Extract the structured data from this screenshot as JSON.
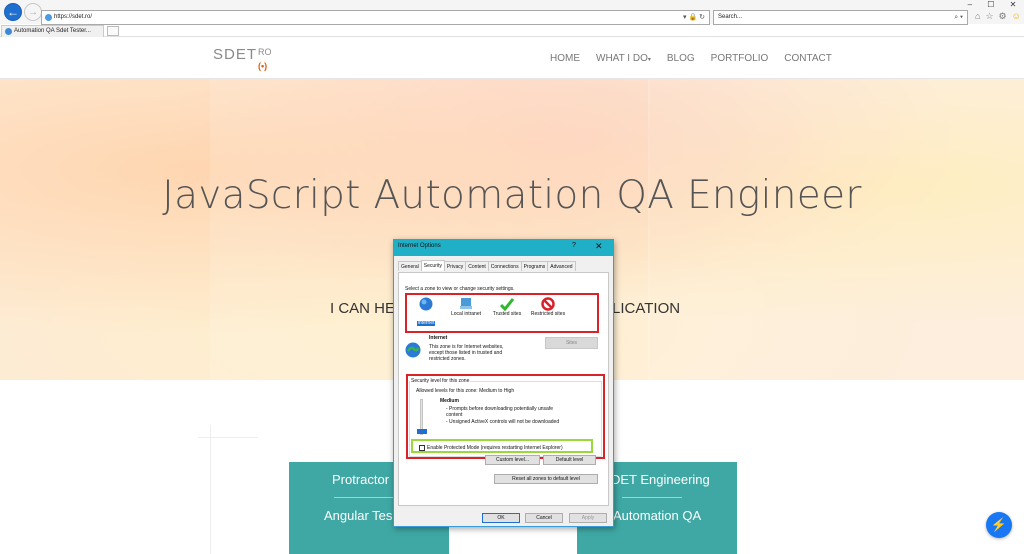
{
  "browser": {
    "url": "https://sdet.ro/",
    "address_icons": "▾ 🔒 ↻",
    "search_placeholder": "Search...",
    "search_icons": "⌕ ▾",
    "tab_title": "Automation QA Sdet Tester...",
    "window_controls": {
      "minimize": "–",
      "maximize": "☐",
      "close": "✕"
    },
    "toolbar_icons": [
      "home-icon",
      "star-icon",
      "gear-icon",
      "smiley-icon"
    ]
  },
  "site": {
    "logo_main": "SDET",
    "logo_signal": "(•)",
    "logo_suffix": "RO",
    "nav": [
      {
        "label": "HOME"
      },
      {
        "label": "WHAT I DO",
        "has_dropdown": true
      },
      {
        "label": "BLOG"
      },
      {
        "label": "PORTFOLIO"
      },
      {
        "label": "CONTACT"
      }
    ],
    "hero_title": "JavaScript Automation QA Engineer",
    "hero_subtitle_left": "I CAN HE",
    "hero_subtitle_right": "LICATION",
    "cards": {
      "left": {
        "title": "Protractor",
        "subtitle": "Angular Tes"
      },
      "right": {
        "title": "DET Engineering",
        "subtitle": "Automation QA"
      }
    }
  },
  "dialog": {
    "title": "Internet Options",
    "help": "?",
    "close": "✕",
    "tabs": [
      "General",
      "Security",
      "Privacy",
      "Content",
      "Connections",
      "Programs",
      "Advanced"
    ],
    "active_tab": "Security",
    "select_zone_text": "Select a zone to view or change security settings.",
    "zones": [
      {
        "label": "Internet",
        "icon": "globe-icon",
        "selected": true
      },
      {
        "label": "Local intranet",
        "icon": "network-icon",
        "selected": false
      },
      {
        "label": "Trusted sites",
        "icon": "checkmark-icon",
        "selected": false
      },
      {
        "label": "Restricted sites",
        "icon": "restricted-icon",
        "selected": false
      }
    ],
    "zone_name": "Internet",
    "zone_description": [
      "This zone is for Internet websites,",
      "except those listed in trusted and",
      "restricted zones."
    ],
    "sites_button": "Sites",
    "security_level_header": "Security level for this zone",
    "allowed_levels": "Allowed levels for this zone: Medium to High",
    "level_name": "Medium",
    "level_details": [
      "- Prompts before downloading potentially unsafe",
      "  content",
      "- Unsigned ActiveX controls will not be downloaded"
    ],
    "protected_mode_label": "Enable Protected Mode (requires restarting Internet Explorer)",
    "protected_mode_checked": false,
    "custom_level_button": "Custom level...",
    "default_level_button": "Default level",
    "reset_all_button": "Reset all zones to default level",
    "ok_button": "OK",
    "cancel_button": "Cancel",
    "apply_button": "Apply"
  },
  "colors": {
    "dialog_titlebar": "#1fb0c8",
    "highlight_red": "#d9222a",
    "highlight_green": "#9bd83a",
    "teal_card": "#3fa8a4",
    "messenger": "#1877f2"
  }
}
